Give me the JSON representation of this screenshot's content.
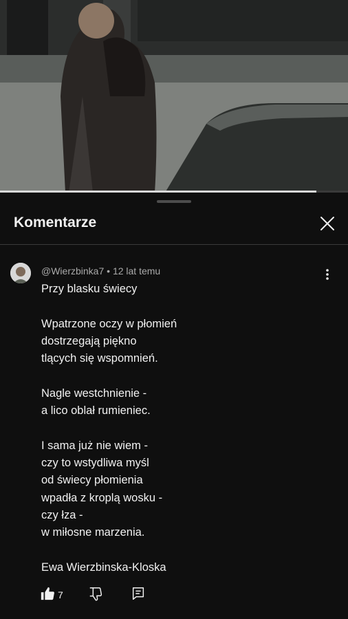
{
  "video": {
    "progress_percent": 91
  },
  "sheet": {
    "title": "Komentarze"
  },
  "comment": {
    "author": "@Wierzbinka7",
    "separator": " • ",
    "time": "12 lat temu",
    "text": "Przy blasku świecy\n\nWpatrzone oczy w płomień\ndostrzegają piękno\ntlących się wspomnień.\n\nNagle westchnienie -\na lico oblał rumieniec.\n\nI sama już nie wiem -\nczy to wstydliwa myśl\nod świecy płomienia\nwpadła z kroplą wosku -\nczy łza -\nw miłosne marzenia.\n\nEwa Wierzbinska-Kloska",
    "like_count": "7"
  },
  "icons": {
    "close": "close-icon",
    "more": "more-vert-icon",
    "like": "thumb-up-icon",
    "dislike": "thumb-down-icon",
    "reply": "reply-icon"
  }
}
